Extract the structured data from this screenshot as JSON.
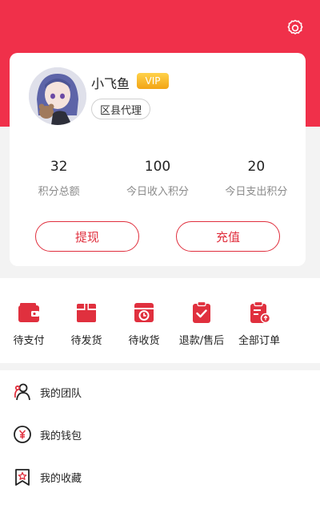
{
  "colors": {
    "brand": "#f0304a",
    "accent": "#e0303e",
    "vip": "#f5b01f"
  },
  "header": {
    "settings_icon": "gear-icon"
  },
  "profile": {
    "name": "小飞鱼",
    "vip_badge": "VIP",
    "level": "区县代理",
    "stats": [
      {
        "value": "32",
        "label": "积分总额"
      },
      {
        "value": "100",
        "label": "今日收入积分"
      },
      {
        "value": "20",
        "label": "今日支出积分"
      }
    ],
    "withdraw_label": "提现",
    "recharge_label": "充值"
  },
  "orders": [
    {
      "label": "待支付",
      "icon": "wallet-icon"
    },
    {
      "label": "待发货",
      "icon": "package-icon"
    },
    {
      "label": "待收货",
      "icon": "clock-box-icon"
    },
    {
      "label": "退款/售后",
      "icon": "clipboard-check-icon"
    },
    {
      "label": "全部订单",
      "icon": "order-list-icon"
    }
  ],
  "menu": [
    {
      "label": "我的团队",
      "icon": "team-icon"
    },
    {
      "label": "我的钱包",
      "icon": "yuan-wallet-icon"
    },
    {
      "label": "我的收藏",
      "icon": "star-bookmark-icon"
    }
  ]
}
